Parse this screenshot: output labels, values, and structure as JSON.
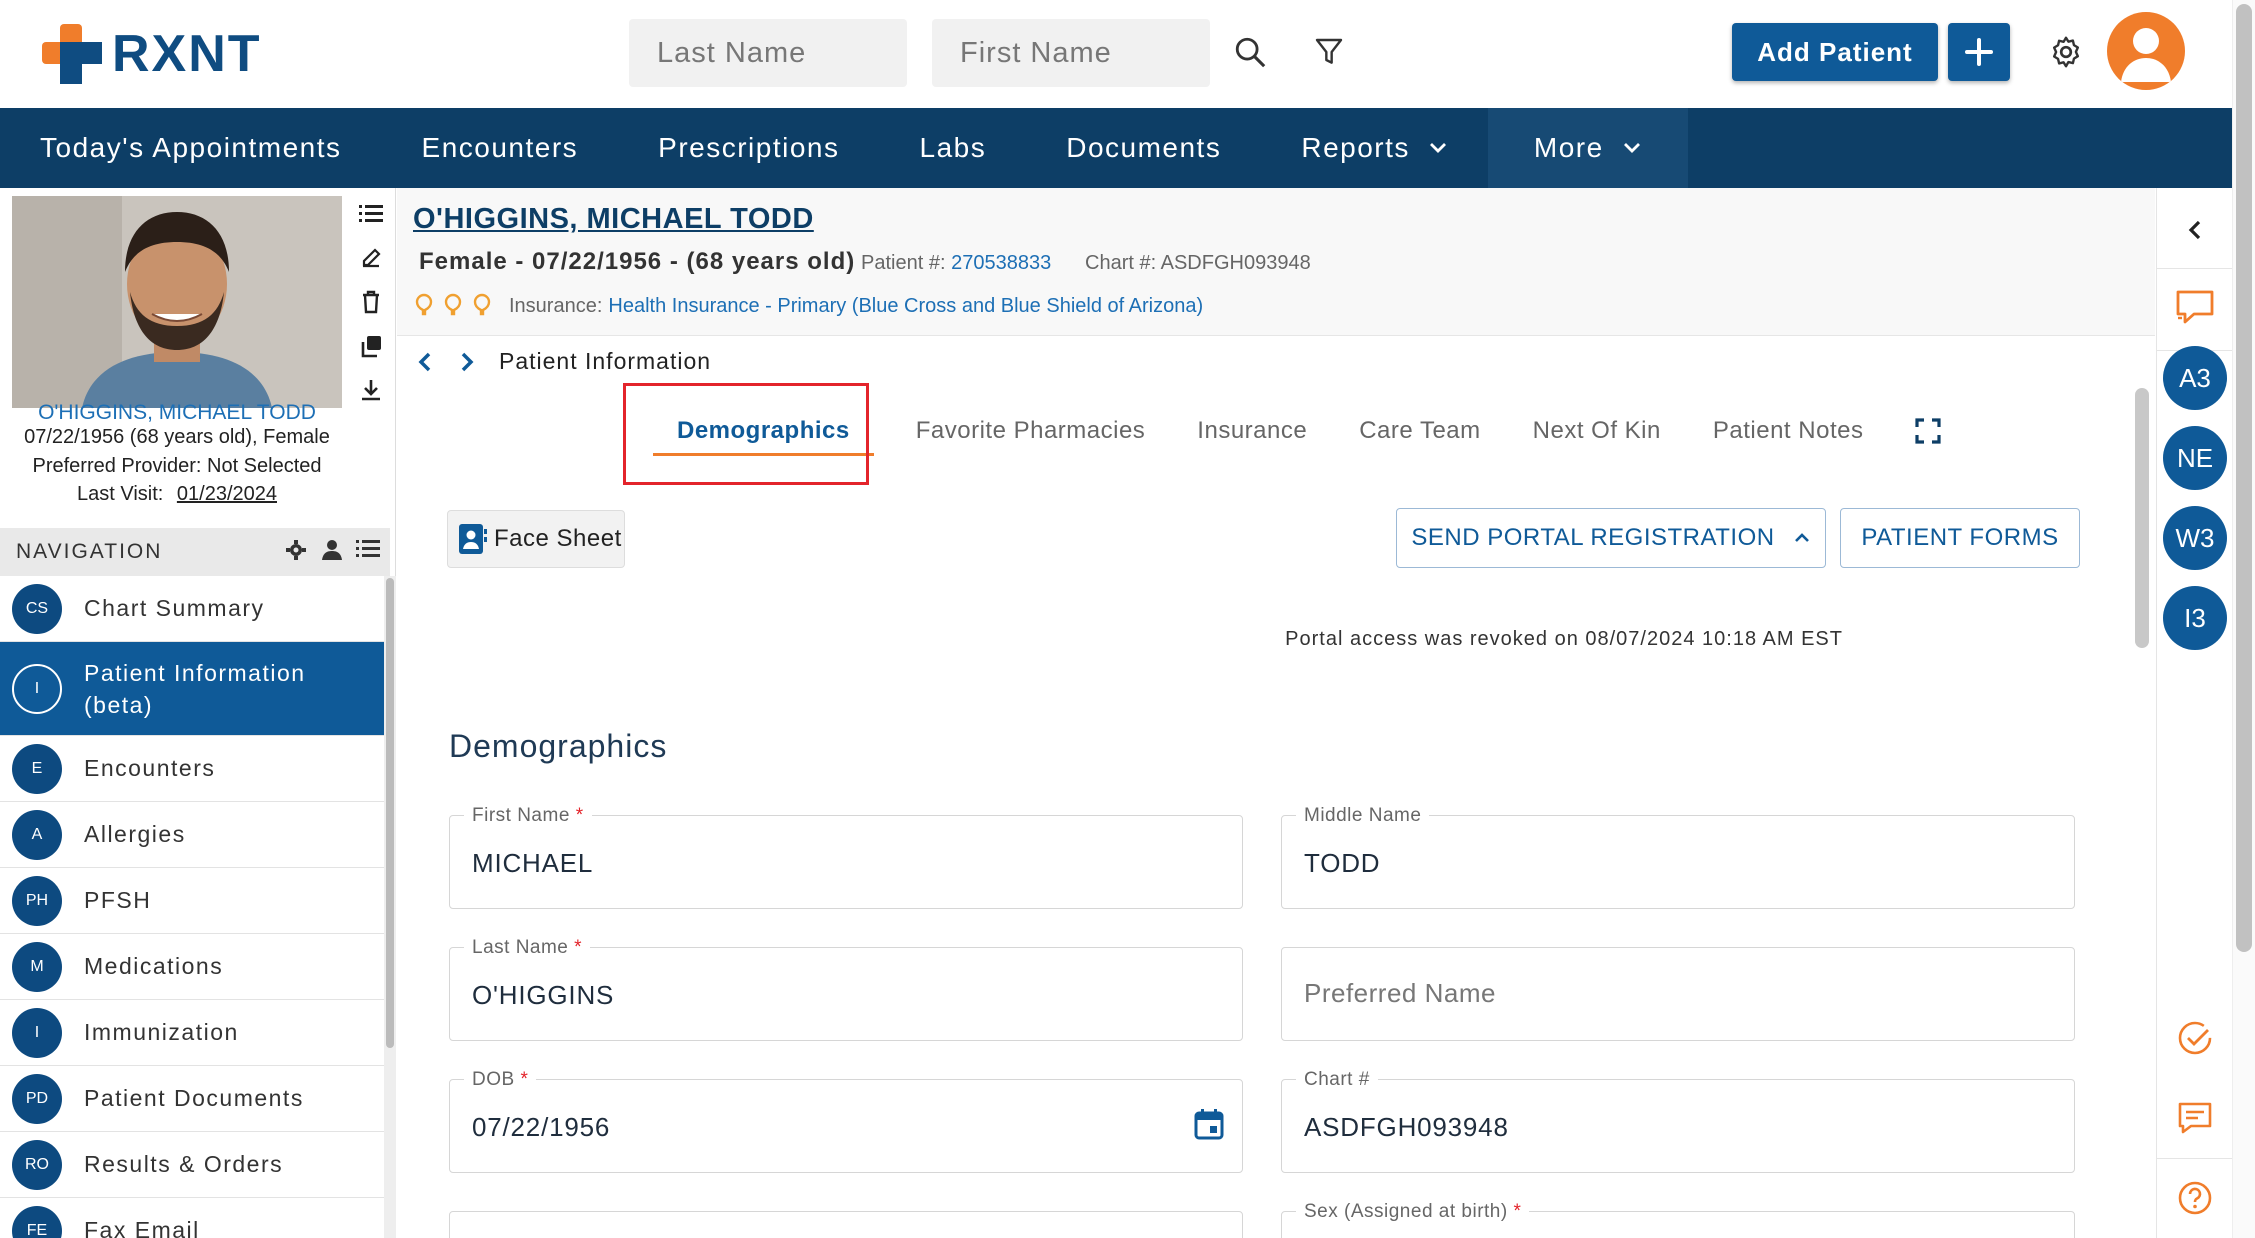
{
  "brand": {
    "name": "RXNT"
  },
  "search": {
    "last_name_placeholder": "Last Name",
    "first_name_placeholder": "First Name"
  },
  "header": {
    "add_patient_label": "Add Patient"
  },
  "navbar": {
    "items": [
      {
        "label": "Today's Appointments"
      },
      {
        "label": "Encounters"
      },
      {
        "label": "Prescriptions"
      },
      {
        "label": "Labs"
      },
      {
        "label": "Documents"
      },
      {
        "label": "Reports"
      },
      {
        "label": "More"
      }
    ]
  },
  "patient_card": {
    "name": "O'HIGGINS, MICHAEL TODD",
    "dob_line": "07/22/1956 (68 years old), Female",
    "provider_line": "Preferred Provider: Not Selected",
    "last_visit_label": "Last Visit:",
    "last_visit_value": "01/23/2024"
  },
  "navigation": {
    "heading": "NAVIGATION",
    "items": [
      {
        "badge": "CS",
        "label": "Chart Summary"
      },
      {
        "badge": "I",
        "label": "Patient Information (beta)"
      },
      {
        "badge": "E",
        "label": "Encounters"
      },
      {
        "badge": "A",
        "label": "Allergies"
      },
      {
        "badge": "PH",
        "label": "PFSH"
      },
      {
        "badge": "M",
        "label": "Medications"
      },
      {
        "badge": "I",
        "label": "Immunization"
      },
      {
        "badge": "PD",
        "label": "Patient Documents"
      },
      {
        "badge": "RO",
        "label": "Results & Orders"
      },
      {
        "badge": "FE",
        "label": "Fax Email"
      }
    ]
  },
  "patient_header": {
    "title": "O'HIGGINS, MICHAEL TODD",
    "subtitle": "Female - 07/22/1956 - (68 years old)",
    "patient_num_label": "Patient #:",
    "patient_num_value": "270538833",
    "chart_num_label": "Chart #:",
    "chart_num_value": "ASDFGH093948",
    "insurance_label": "Insurance:",
    "insurance_value": "Health Insurance - Primary (Blue Cross and Blue Shield of Arizona)"
  },
  "breadcrumb": {
    "current": "Patient Information"
  },
  "tabs": [
    {
      "label": "Demographics"
    },
    {
      "label": "Favorite Pharmacies"
    },
    {
      "label": "Insurance"
    },
    {
      "label": "Care Team"
    },
    {
      "label": "Next Of Kin"
    },
    {
      "label": "Patient Notes"
    }
  ],
  "actions": {
    "face_sheet": "Face Sheet",
    "send_portal": "SEND PORTAL REGISTRATION",
    "patient_forms": "PATIENT FORMS"
  },
  "portal_note": "Portal access was revoked on 08/07/2024 10:18 AM EST",
  "demographics": {
    "section_title": "Demographics",
    "first_name": {
      "label": "First Name",
      "value": "MICHAEL"
    },
    "middle_name": {
      "label": "Middle Name",
      "value": "TODD"
    },
    "last_name": {
      "label": "Last Name",
      "value": "O'HIGGINS"
    },
    "preferred_name": {
      "placeholder": "Preferred Name"
    },
    "dob": {
      "label": "DOB",
      "value": "07/22/1956"
    },
    "chart": {
      "label": "Chart #",
      "value": "ASDFGH093948"
    },
    "sex": {
      "label": "Sex (Assigned at birth)"
    }
  },
  "rail": {
    "badges": [
      "A3",
      "NE",
      "W3",
      "I3"
    ]
  },
  "colors": {
    "brand_navy": "#0d3e66",
    "brand_blue": "#0f5a98",
    "accent_orange": "#f07d2b",
    "highlight_red": "#e3242b"
  }
}
